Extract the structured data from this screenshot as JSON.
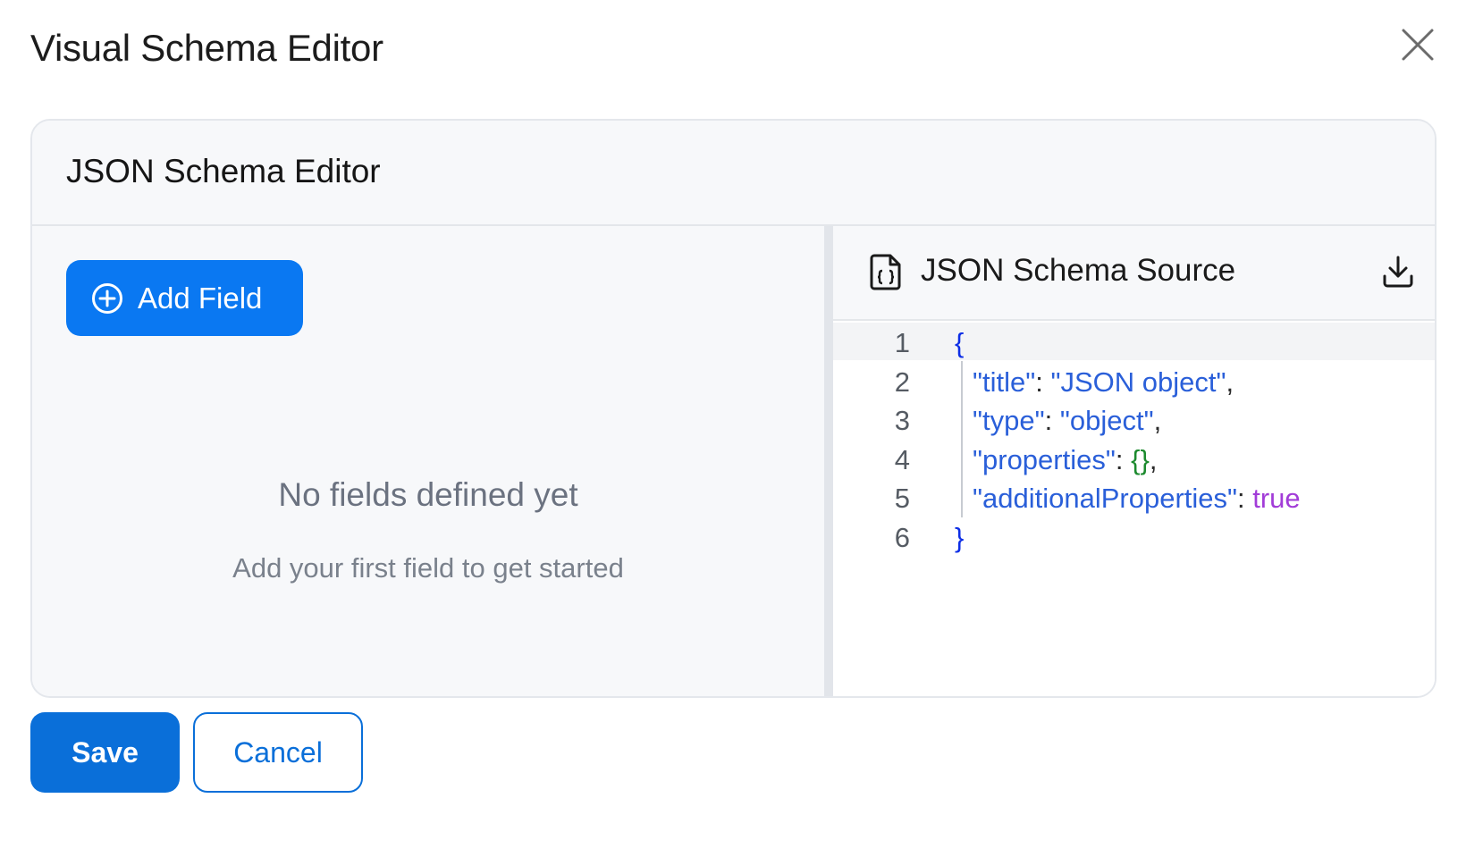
{
  "dialog": {
    "title": "Visual Schema Editor",
    "close_icon": "close-icon"
  },
  "panel": {
    "title": "JSON Schema Editor"
  },
  "left": {
    "add_field_label": "Add Field",
    "add_field_icon": "plus-circle-icon",
    "empty_title": "No fields defined yet",
    "empty_subtitle": "Add your first field to get started"
  },
  "source": {
    "title": "JSON Schema Source",
    "file_icon": "json-file-icon",
    "download_icon": "download-icon",
    "lines": [
      {
        "no": "1",
        "tokens": [
          {
            "t": "{",
            "c": "brace"
          }
        ]
      },
      {
        "no": "2",
        "tokens": [
          {
            "t": "\"title\"",
            "c": "key"
          },
          {
            "t": ": ",
            "c": "punc"
          },
          {
            "t": "\"JSON object\"",
            "c": "str"
          },
          {
            "t": ",",
            "c": "punc"
          }
        ]
      },
      {
        "no": "3",
        "tokens": [
          {
            "t": "\"type\"",
            "c": "key"
          },
          {
            "t": ": ",
            "c": "punc"
          },
          {
            "t": "\"object\"",
            "c": "str"
          },
          {
            "t": ",",
            "c": "punc"
          }
        ]
      },
      {
        "no": "4",
        "tokens": [
          {
            "t": "\"properties\"",
            "c": "key"
          },
          {
            "t": ": ",
            "c": "punc"
          },
          {
            "t": "{}",
            "c": "obj"
          },
          {
            "t": ",",
            "c": "punc"
          }
        ]
      },
      {
        "no": "5",
        "tokens": [
          {
            "t": "\"additionalProperties\"",
            "c": "key"
          },
          {
            "t": ": ",
            "c": "punc"
          },
          {
            "t": "true",
            "c": "bool"
          }
        ]
      },
      {
        "no": "6",
        "tokens": [
          {
            "t": "}",
            "c": "brace"
          }
        ]
      }
    ]
  },
  "footer": {
    "save_label": "Save",
    "cancel_label": "Cancel"
  },
  "colors": {
    "primary": "#0a78f2",
    "save": "#0a6fd9",
    "brace": "#0d2ee6",
    "key": "#2a5fd9",
    "object": "#1c8a2e",
    "boolean": "#a23cd8"
  }
}
